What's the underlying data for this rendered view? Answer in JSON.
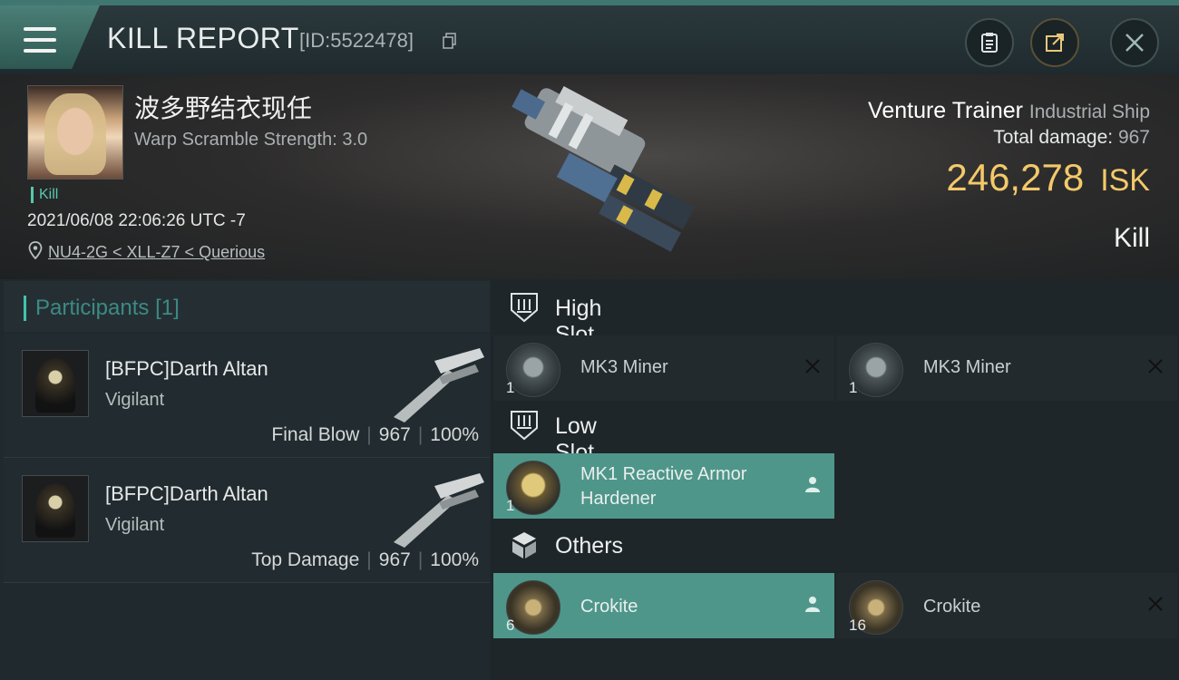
{
  "header": {
    "title": "KILL REPORT",
    "report_id": "[ID:5522478]"
  },
  "victim": {
    "name": "波多野结衣现任",
    "warp": "Warp Scramble Strength: 3.0",
    "tag": "Kill",
    "datetime": "2021/06/08 22:06:26 UTC -7",
    "location": "NU4-2G < XLL-Z7 < Querious"
  },
  "ship": {
    "name": "Venture Trainer",
    "class": "Industrial Ship",
    "total_damage_label": "Total damage:",
    "total_damage": "967",
    "isk_value": "246,278",
    "isk_unit": "ISK",
    "result": "Kill"
  },
  "participants": {
    "label": "Participants",
    "count": "[1]",
    "rows": [
      {
        "name": "[BFPC]Darth Altan",
        "ship": "Vigilant",
        "role": "Final Blow",
        "damage": "967",
        "percent": "100%"
      },
      {
        "name": "[BFPC]Darth Altan",
        "ship": "Vigilant",
        "role": "Top Damage",
        "damage": "967",
        "percent": "100%"
      }
    ]
  },
  "slots": {
    "high": {
      "label": "High Slot",
      "items": [
        {
          "name": "MK3 Miner",
          "qty": "1",
          "status": "destroyed"
        },
        {
          "name": "MK3 Miner",
          "qty": "1",
          "status": "destroyed"
        }
      ]
    },
    "low": {
      "label": "Low Slot",
      "items": [
        {
          "name_line1": "MK1 Reactive Armor",
          "name_line2": "Hardener",
          "qty": "1",
          "status": "dropped"
        }
      ]
    },
    "others": {
      "label": "Others",
      "items": [
        {
          "name": "Crokite",
          "qty": "6",
          "status": "dropped"
        },
        {
          "name": "Crokite",
          "qty": "16",
          "status": "destroyed"
        }
      ]
    }
  },
  "colors": {
    "accent": "#4f968a",
    "isk": "#f3c96a",
    "kill_tag": "#58c7ae"
  },
  "icons": [
    "menu-icon",
    "copy-icon",
    "clipboard-icon",
    "share-icon",
    "close-icon",
    "pin-icon",
    "high-slot-icon",
    "low-slot-icon",
    "cube-icon",
    "person-icon",
    "x-icon"
  ]
}
